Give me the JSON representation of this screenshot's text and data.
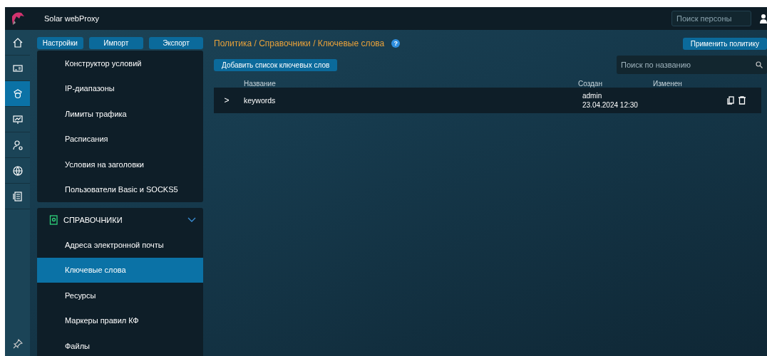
{
  "app": {
    "title": "Solar webProxy",
    "person_search": {
      "placeholder": "Поиск персоны"
    }
  },
  "rail": [
    {
      "kind": "home",
      "selected": false
    },
    {
      "kind": "card",
      "selected": false
    },
    {
      "kind": "guard",
      "selected": true
    },
    {
      "kind": "chart",
      "selected": false
    },
    {
      "kind": "user",
      "selected": false
    },
    {
      "kind": "globe",
      "selected": false
    },
    {
      "kind": "doc",
      "selected": false
    }
  ],
  "toolbar": [
    "Настройки",
    "Импорт",
    "Экспорт"
  ],
  "nav_groups": [
    {
      "items": [
        {
          "label": "Конструктор условий",
          "selected": false
        },
        {
          "label": "IP-диапазоны",
          "selected": false
        },
        {
          "label": "Лимиты трафика",
          "selected": false
        },
        {
          "label": "Расписания",
          "selected": false
        },
        {
          "label": "Условия на заголовки",
          "selected": false
        },
        {
          "label": "Пользователи Basic и SOCKS5",
          "selected": false
        }
      ]
    },
    {
      "title": "СПРАВОЧНИКИ",
      "expanded": true,
      "items": [
        {
          "label": "Адреса электронной почты",
          "selected": false
        },
        {
          "label": "Ключевые слова",
          "selected": true
        },
        {
          "label": "Ресурсы",
          "selected": false
        },
        {
          "label": "Маркеры правил КФ",
          "selected": false
        },
        {
          "label": "Файлы",
          "selected": false
        }
      ]
    }
  ],
  "breadcrumb": "Политика / Справочники / Ключевые слова",
  "help": "?",
  "apply_button": "Применить политику",
  "add_button": "Добавить список ключевых слов",
  "name_search": {
    "placeholder": "Поиск по названию"
  },
  "table": {
    "columns": [
      "Название",
      "Создан",
      "Изменен"
    ],
    "rows": [
      {
        "expand": ">",
        "name": "keywords",
        "expanded": false,
        "created_by": "admin",
        "created_at": "23.04.2024 12:30"
      }
    ]
  }
}
